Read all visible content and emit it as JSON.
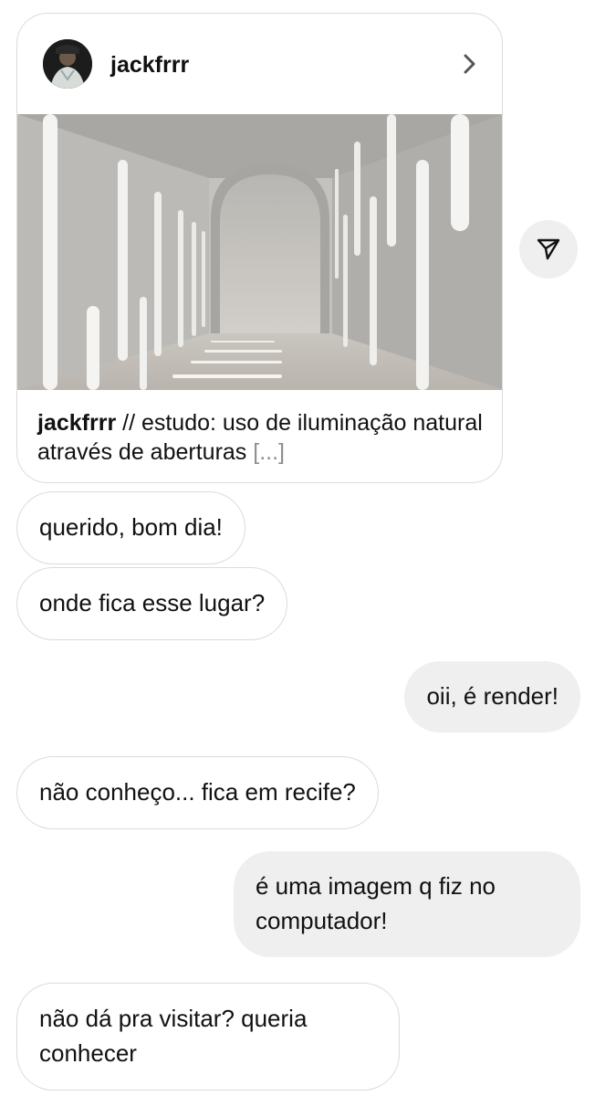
{
  "shared_post": {
    "username": "jackfrrr",
    "caption_user": "jackfrrr",
    "caption_text": " // estudo: uso de iluminação natural através de aberturas ",
    "caption_more": "[...]"
  },
  "messages": [
    {
      "side": "in",
      "text": "querido, bom dia!"
    },
    {
      "side": "in",
      "text": "onde fica esse lugar?"
    },
    {
      "side": "out",
      "text": "oii, é render!"
    },
    {
      "side": "in",
      "text": "não conheço... fica em recife?"
    },
    {
      "side": "out",
      "text": "é uma imagem q fiz no computador!"
    },
    {
      "side": "in",
      "text": "não dá pra visitar? queria conhecer"
    }
  ],
  "icons": {
    "chevron": "chevron-right-icon",
    "share": "paper-plane-icon"
  }
}
